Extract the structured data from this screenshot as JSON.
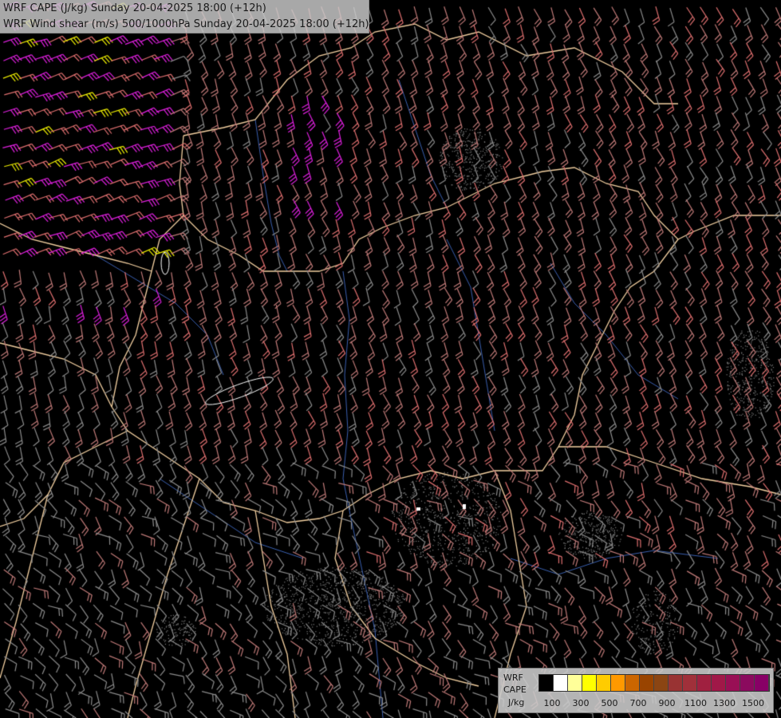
{
  "header": {
    "line1": "WRF CAPE (J/kg) Sunday 20-04-2025 18:00 (+12h)",
    "line2": "WRF Wind shear (m/s) 500/1000hPa Sunday 20-04-2025 18:00 (+12h)"
  },
  "legend": {
    "label_line1": "WRF",
    "label_line2": "CAPE",
    "label_line3": "J/kg",
    "ticks": [
      "100",
      "300",
      "500",
      "700",
      "900",
      "1100",
      "1300",
      "1500"
    ],
    "colors": [
      "#000000",
      "#ffffff",
      "#ffff99",
      "#ffff00",
      "#ffcc00",
      "#ff9900",
      "#cc6600",
      "#994400",
      "#8b4513",
      "#993333",
      "#a0303a",
      "#a02040",
      "#a01848",
      "#990f55",
      "#8b0a5e",
      "#880066"
    ]
  },
  "map": {
    "background": "#000000",
    "border_color": "#f2cfa0",
    "river_color": "#3a5fb0",
    "barb_colors": {
      "low": "#8c8c8c",
      "medium": "#c07a78",
      "high": "#e07070",
      "very_high": "#e020e0",
      "extreme": "#f0f000"
    }
  }
}
